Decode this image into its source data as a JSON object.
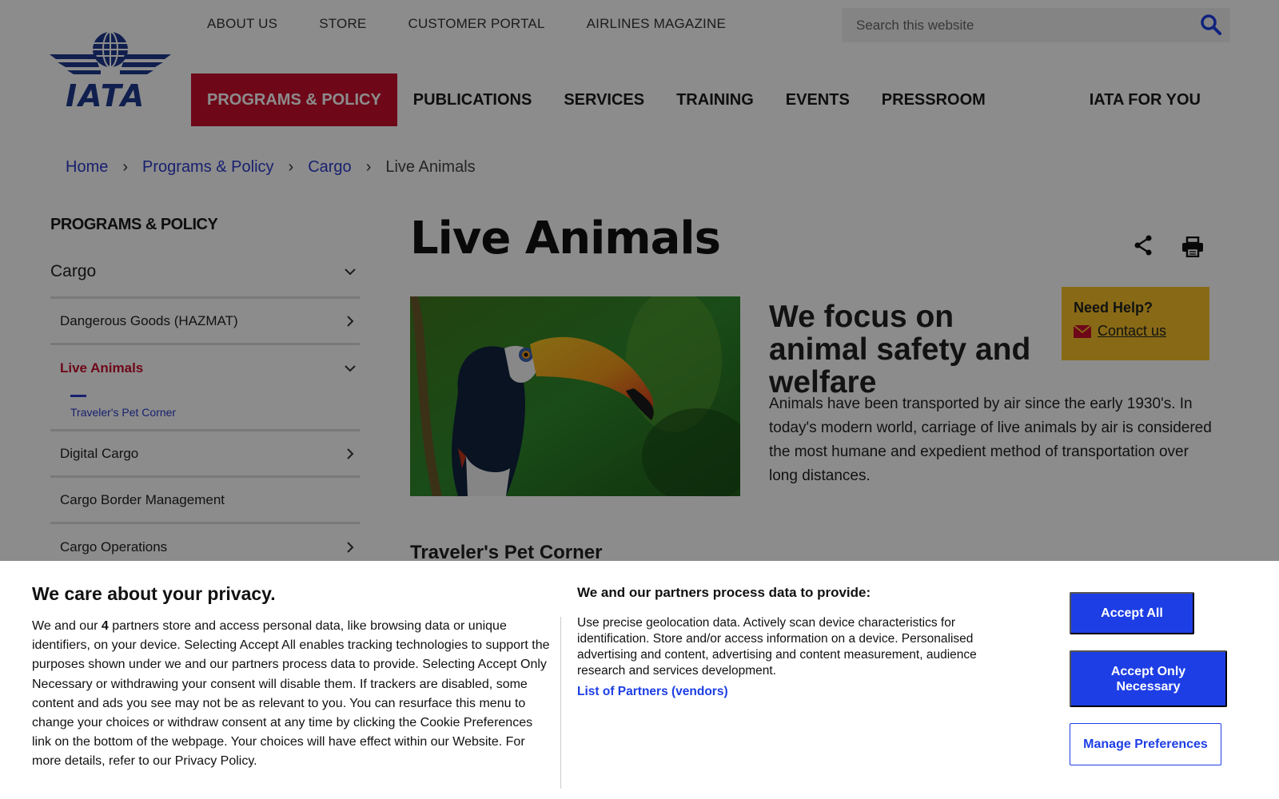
{
  "colors": {
    "brand_red": "#c8102e",
    "link_blue": "#2c3bc9",
    "cookie_button_blue": "#1d3ee5",
    "help_box_yellow": "#f7c229",
    "iata_logo_blue": "#1e3a8f"
  },
  "logo": {
    "text": "IATA"
  },
  "utility_nav": [
    "ABOUT US",
    "STORE",
    "CUSTOMER PORTAL",
    "AIRLINES MAGAZINE"
  ],
  "search": {
    "placeholder": "Search this website",
    "icon": "search-icon"
  },
  "main_nav": {
    "items": [
      "PROGRAMS & POLICY",
      "PUBLICATIONS",
      "SERVICES",
      "TRAINING",
      "EVENTS",
      "PRESSROOM"
    ],
    "active_index": 0,
    "right_item": "IATA FOR YOU"
  },
  "breadcrumb": {
    "items": [
      "Home",
      "Programs & Policy",
      "Cargo"
    ],
    "current": "Live Animals"
  },
  "sidebar": {
    "title": "PROGRAMS & POLICY",
    "section": "Cargo",
    "items": [
      "Dangerous Goods (HAZMAT)",
      "Live Animals",
      "Digital Cargo",
      "Cargo Border Management",
      "Cargo Operations"
    ],
    "active_item": "Live Animals",
    "sub_item": "Traveler's Pet Corner"
  },
  "page": {
    "title": "Live Animals",
    "focus_heading": "We focus on animal safety and welfare",
    "focus_body": "Animals have been transported by air since the early 1930's. In today's modern world, carriage of live animals by air is considered the most humane and expedient method of transportation over long distances.",
    "section_heading": "Traveler's Pet Corner"
  },
  "help": {
    "title": "Need Help?",
    "link": "Contact us"
  },
  "cookie": {
    "title": "We care about your privacy.",
    "body_pre": "We and our ",
    "body_count": "4",
    "body_post": " partners store and access personal data, like browsing data or unique identifiers, on your device. Selecting Accept All enables tracking technologies to support the purposes shown under we and our partners process data to provide. Selecting Accept Only Necessary or withdrawing your consent will disable them. If trackers are disabled, some content and ads you see may not be as relevant to you. You can resurface this menu to change your choices or withdraw consent at any time by clicking the Cookie Preferences link on the bottom of the webpage. Your choices will have effect within our Website. For more details, refer to our Privacy Policy.",
    "purposes_title": "We and our partners process data to provide:",
    "purposes_body": "Use precise geolocation data. Actively scan device characteristics for identification. Store and/or access information on a device. Personalised advertising and content, advertising and content measurement, audience research and services development.",
    "partners_link": "List of Partners (vendors)",
    "accept_all": "Accept All",
    "accept_necessary": "Accept Only Necessary",
    "manage": "Manage Preferences"
  }
}
